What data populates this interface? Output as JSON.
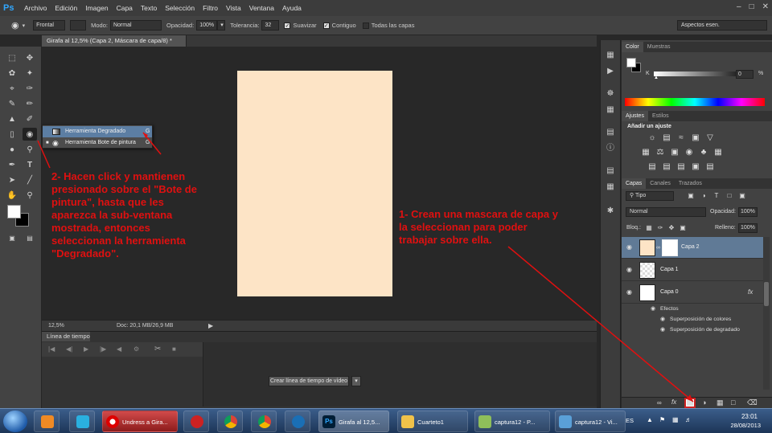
{
  "menu": {
    "logo": "Ps",
    "items": [
      "Archivo",
      "Edición",
      "Imagen",
      "Capa",
      "Texto",
      "Selección",
      "Filtro",
      "Vista",
      "Ventana",
      "Ayuda"
    ]
  },
  "options": {
    "preset": "Frontal",
    "mode_label": "Modo:",
    "mode_value": "Normal",
    "opacity_label": "Opacidad:",
    "opacity_value": "100%",
    "tolerance_label": "Tolerancia:",
    "tolerance_value": "32",
    "smooth_label": "Suavizar",
    "contiguous_label": "Contiguo",
    "all_layers_label": "Todas las capas",
    "workspace": "Aspectos esen."
  },
  "document": {
    "tab_title": "Girafa al 12,5% (Capa 2, Máscara de capa/8) *",
    "zoom": "12,5%",
    "doc_size": "Doc: 20,1 MB/26,9 MB"
  },
  "timeline": {
    "tab": "Línea de tiempo",
    "create_button": "Crear línea de tiempo de vídeo"
  },
  "flyout": {
    "items": [
      {
        "label": "Herramienta Degradado",
        "key": "G"
      },
      {
        "label": "Herramienta Bote de pintura",
        "key": "G"
      }
    ]
  },
  "panels": {
    "color_tabs": [
      "Color",
      "Muestras"
    ],
    "k_label": "K",
    "k_value": "0",
    "k_unit": "%",
    "adjust_tabs": [
      "Ajustes",
      "Estilos"
    ],
    "add_adjust": "Añadir un ajuste",
    "layers_tabs": [
      "Capas",
      "Canales",
      "Trazados"
    ],
    "filter_kind": "Tipo",
    "blend_mode": "Normal",
    "opacity_label": "Opacidad:",
    "opacity_value": "100%",
    "lock_label": "Bloq.:",
    "fill_label": "Relleno:",
    "fill_value": "100%",
    "layers": [
      {
        "name": "Capa 2"
      },
      {
        "name": "Capa 1"
      },
      {
        "name": "Capa 0"
      }
    ],
    "fx": "fx",
    "effects_label": "Efectos",
    "effects": [
      "Superposición de colores",
      "Superposición de degradado"
    ]
  },
  "annotations": {
    "note_2": [
      "2- Hacen click y mantienen",
      "presionado sobre el \"Bote de",
      "pintura\", hasta que les",
      "aparezca la sub-ventana",
      "mostrada, entonces",
      "seleccionan la herramienta",
      "\"Degradado\"."
    ],
    "note_1": [
      "1- Crean una mascara de capa y",
      "la seleccionan para poder",
      "trabajar sobre ella."
    ]
  },
  "taskbar": {
    "tasks": [
      "Undress a Gira...",
      "Girafa al 12,5...",
      "Cuarteto1",
      "captura12 - P...",
      "captura12 - Vi..."
    ],
    "lang": "ES",
    "time": "23:01",
    "date": "28/08/2013"
  },
  "colors": {
    "canvas_page": "#fde4c6",
    "annotation": "#e01010",
    "selected_layer": "#607a96"
  }
}
